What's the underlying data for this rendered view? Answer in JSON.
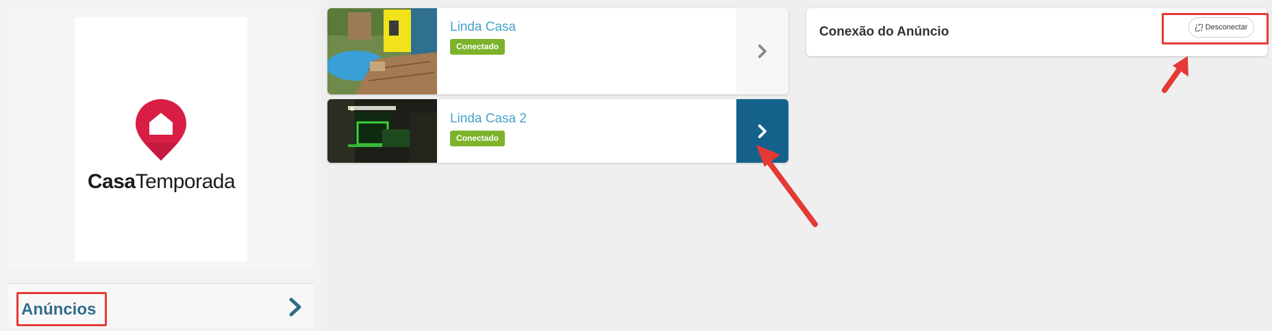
{
  "sidebar": {
    "logo": {
      "word_bold": "Casa",
      "word_regular": "Temporada",
      "brand_color": "#d81e45"
    },
    "nav": {
      "label": "Anúncios"
    }
  },
  "listings": [
    {
      "title": "Linda Casa",
      "badge": "Conectado",
      "selected": false
    },
    {
      "title": "Linda Casa 2",
      "badge": "Conectado",
      "selected": true
    }
  ],
  "connection": {
    "title": "Conexão do Anúncio",
    "disconnect_label": "Desconectar"
  },
  "colors": {
    "accent": "#14628b",
    "badge": "#7cb32b",
    "link": "#45a3c9",
    "annotation": "#e53935"
  }
}
